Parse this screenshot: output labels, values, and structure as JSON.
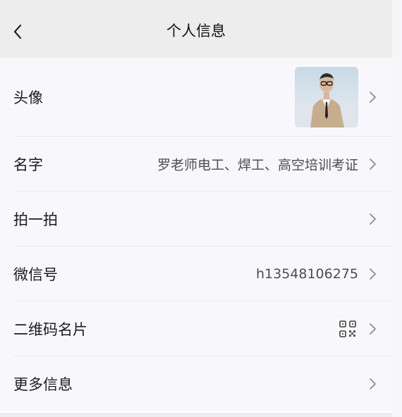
{
  "header": {
    "title": "个人信息",
    "back_icon": "chevron-left-icon"
  },
  "profile": {
    "rows": [
      {
        "label": "头像",
        "type": "avatar"
      },
      {
        "label": "名字",
        "value": "罗老师电工、焊工、高空培训考证"
      },
      {
        "label": "拍一拍"
      },
      {
        "label": "微信号",
        "value": "h13548106275"
      },
      {
        "label": "二维码名片",
        "icon": "qr-code-icon"
      },
      {
        "label": "更多信息"
      }
    ]
  },
  "colors": {
    "header_bg": "#ededed",
    "list_bg": "#f8f8fc",
    "chevron": "#8c8c8c"
  }
}
